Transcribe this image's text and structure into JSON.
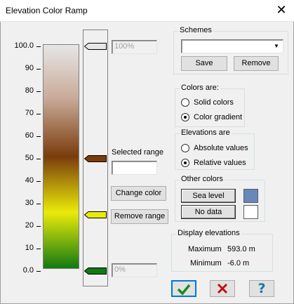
{
  "window": {
    "title": "Elevation Color Ramp",
    "close_glyph": "✕"
  },
  "scale": {
    "ticks": [
      "100.0",
      "90",
      "80",
      "70",
      "60",
      "50",
      "40",
      "30",
      "20",
      "10",
      "0.0"
    ]
  },
  "ramp": {
    "gradient_stops": [
      {
        "color": "#e6e6e6",
        "at": 0
      },
      {
        "color": "#c8aa98",
        "at": 24
      },
      {
        "color": "#7a3c0c",
        "at": 50
      },
      {
        "color": "#eaea0a",
        "at": 75
      },
      {
        "color": "#127a12",
        "at": 100
      }
    ]
  },
  "markers": [
    {
      "name": "top",
      "value_percent": 100,
      "color": "#e6e6e6"
    },
    {
      "name": "mid",
      "value_percent": 50,
      "color": "#7a3c0c"
    },
    {
      "name": "selected",
      "value_percent": 25,
      "color": "#eaea0a"
    },
    {
      "name": "bottom",
      "value_percent": 0,
      "color": "#127a12"
    }
  ],
  "top_value_field": "100%",
  "bottom_value_field": "0%",
  "selected_range": {
    "label": "Selected range",
    "value": ""
  },
  "buttons": {
    "change_color": "Change color",
    "remove_range": "Remove range",
    "save": "Save",
    "remove": "Remove",
    "sea_level": "Sea level",
    "no_data": "No data"
  },
  "schemes": {
    "legend": "Schemes",
    "selected": ""
  },
  "colors_are": {
    "legend": "Colors are:",
    "options": [
      "Solid colors",
      "Color gradient"
    ],
    "selected_index": 1
  },
  "elevations_are": {
    "legend": "Elevations are",
    "options": [
      "Absolute values",
      "Relative values"
    ],
    "selected_index": 1
  },
  "other_colors": {
    "legend": "Other colors",
    "sea_level_color": "#6688bb",
    "no_data_color": "#ffffff"
  },
  "display_elevations": {
    "legend": "Display elevations",
    "maximum_label": "Maximum",
    "maximum_value": "593.0 m",
    "minimum_label": "Minimum",
    "minimum_value": "-6.0 m"
  },
  "footer": {
    "ok_icon": "check-icon",
    "cancel_icon": "x-icon",
    "help_icon": "question-icon",
    "ok_color": "#1a8a1a",
    "cancel_color": "#c01010",
    "help_color": "#1a7a9a"
  }
}
